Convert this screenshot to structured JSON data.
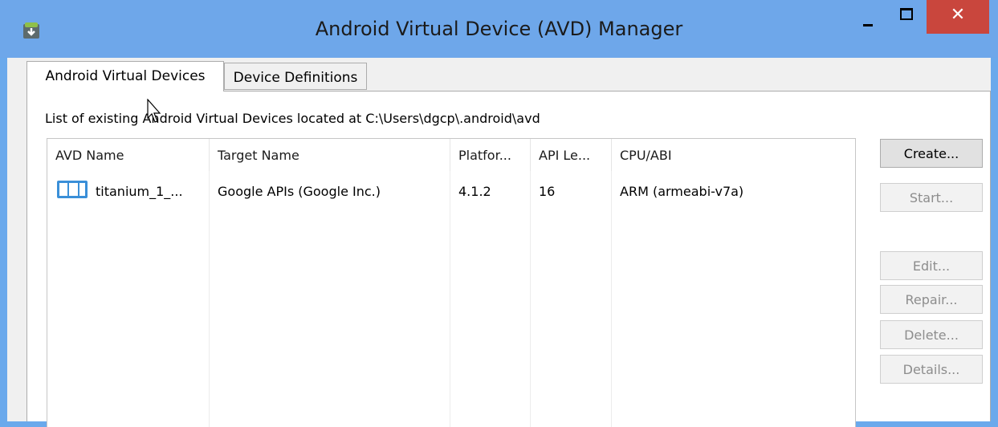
{
  "window": {
    "title": "Android Virtual Device (AVD) Manager",
    "close_glyph": "✕"
  },
  "tabs": [
    {
      "label": "Android Virtual Devices",
      "active": true
    },
    {
      "label": "Device Definitions",
      "active": false
    }
  ],
  "list_label": "List of existing Android Virtual Devices located at C:\\Users\\dgcp\\.android\\avd",
  "table": {
    "columns": [
      "AVD Name",
      "Target Name",
      "Platfor...",
      "API Le...",
      "CPU/ABI"
    ],
    "rows": [
      {
        "avd_name": "titanium_1_...",
        "target_name": "Google APIs (Google Inc.)",
        "platform": "4.1.2",
        "api_level": "16",
        "cpu_abi": "ARM (armeabi-v7a)",
        "icon": "device-icon"
      }
    ]
  },
  "buttons": {
    "create": "Create...",
    "start": "Start...",
    "edit": "Edit...",
    "repair": "Repair...",
    "delete": "Delete...",
    "details": "Details..."
  },
  "colors": {
    "titlebar": "#6ea7ea",
    "close": "#c9463d",
    "device_icon": "#3a8fd8"
  }
}
